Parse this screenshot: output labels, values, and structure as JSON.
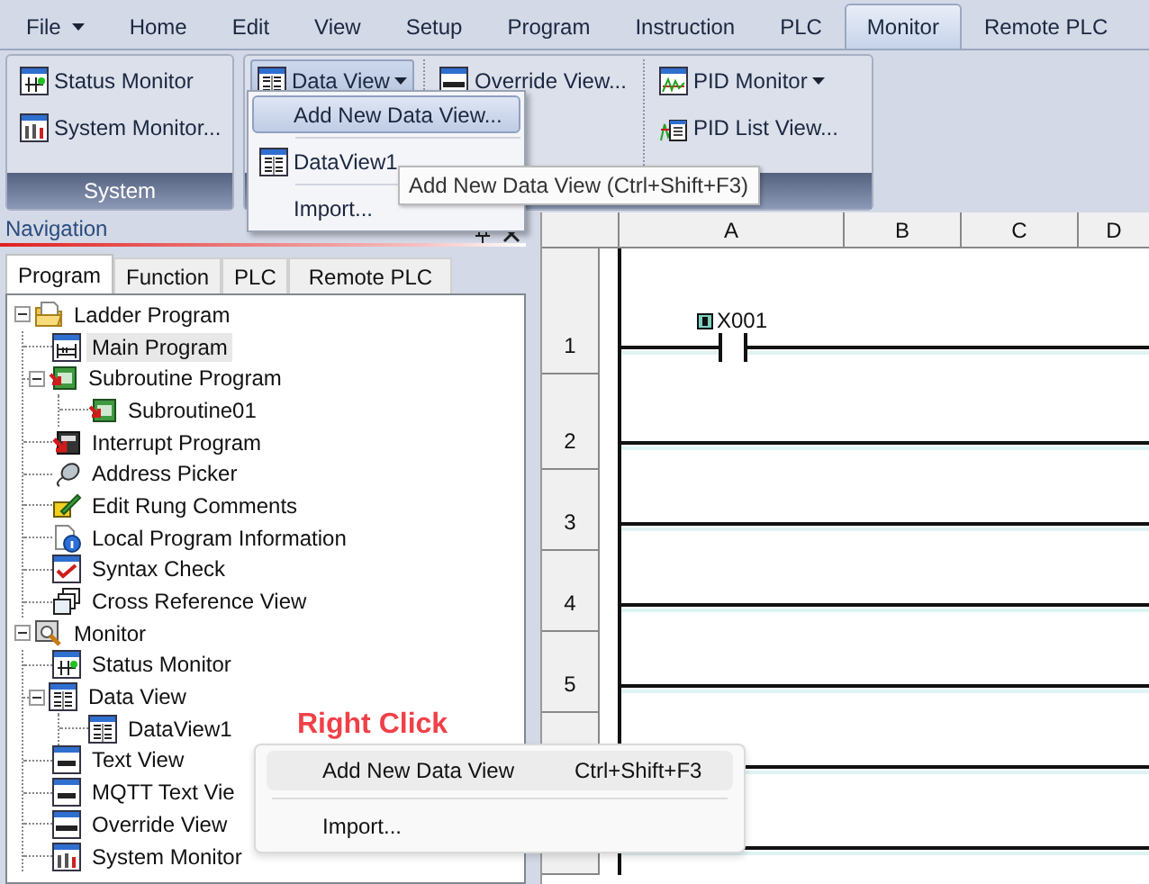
{
  "menu_tabs": [
    {
      "label": "File",
      "dropdown": true,
      "selected": false
    },
    {
      "label": "Home",
      "dropdown": false,
      "selected": false
    },
    {
      "label": "Edit",
      "dropdown": false,
      "selected": false
    },
    {
      "label": "View",
      "dropdown": false,
      "selected": false
    },
    {
      "label": "Setup",
      "dropdown": false,
      "selected": false
    },
    {
      "label": "Program",
      "dropdown": false,
      "selected": false
    },
    {
      "label": "Instruction",
      "dropdown": false,
      "selected": false
    },
    {
      "label": "PLC",
      "dropdown": false,
      "selected": false
    },
    {
      "label": "Monitor",
      "dropdown": false,
      "selected": true
    },
    {
      "label": "Remote PLC",
      "dropdown": false,
      "selected": false
    }
  ],
  "ribbon": {
    "groups": [
      {
        "label": "System",
        "columns": [
          [
            {
              "label": "Status Monitor",
              "kind": "status",
              "dropdown": false,
              "pressed": false
            },
            {
              "label": "System Monitor...",
              "kind": "system",
              "dropdown": false,
              "pressed": false
            }
          ]
        ]
      },
      {
        "columns": [
          [
            {
              "label": "Data View",
              "kind": "dataview",
              "dropdown": true,
              "pressed": true
            }
          ],
          [
            {
              "label": "Override View...",
              "kind": "override",
              "dropdown": false,
              "pressed": false
            }
          ],
          [
            {
              "label": "PID Monitor",
              "kind": "pid",
              "dropdown": true,
              "pressed": false
            },
            {
              "label": "PID List View...",
              "kind": "pidlist",
              "dropdown": false,
              "pressed": false
            }
          ]
        ]
      }
    ]
  },
  "dropdown_menu": {
    "items": [
      {
        "kind": "command",
        "label": "Add New Data View...",
        "selected": true
      },
      {
        "kind": "view",
        "label": "DataView1",
        "selected": false
      },
      {
        "kind": "command",
        "label": "Import...",
        "selected": false
      }
    ]
  },
  "tooltip": "Add New Data View (Ctrl+Shift+F3)",
  "navigation": {
    "title": "Navigation",
    "tabs": [
      {
        "label": "Program",
        "selected": true
      },
      {
        "label": "Function",
        "selected": false
      },
      {
        "label": "PLC",
        "selected": false
      },
      {
        "label": "Remote PLC",
        "selected": false
      }
    ],
    "tree": [
      {
        "label": "Ladder Program",
        "kind": "folder",
        "selected": false,
        "expanded": true,
        "children": [
          {
            "label": "Main Program",
            "kind": "ladder",
            "selected": true
          },
          {
            "label": "Subroutine Program",
            "kind": "routine",
            "selected": false,
            "expanded": true,
            "children": [
              {
                "label": "Subroutine01",
                "kind": "routine",
                "selected": false
              }
            ]
          },
          {
            "label": "Interrupt Program",
            "kind": "interrupt",
            "selected": false
          },
          {
            "label": "Address Picker",
            "kind": "picker",
            "selected": false
          },
          {
            "label": "Edit Rung Comments",
            "kind": "comment",
            "selected": false
          },
          {
            "label": "Local Program Information",
            "kind": "info",
            "selected": false
          },
          {
            "label": "Syntax Check",
            "kind": "check",
            "selected": false
          },
          {
            "label": "Cross Reference View",
            "kind": "reference",
            "selected": false
          }
        ]
      },
      {
        "label": "Monitor",
        "kind": "monitor",
        "selected": false,
        "expanded": true,
        "children": [
          {
            "label": "Status Monitor",
            "kind": "status",
            "selected": false
          },
          {
            "label": "Data View",
            "kind": "dataview",
            "selected": false,
            "expanded": true,
            "children": [
              {
                "label": "DataView1",
                "kind": "dataview",
                "selected": false
              }
            ]
          },
          {
            "label": "Text View",
            "kind": "text",
            "selected": false
          },
          {
            "label": "MQTT Text Vie",
            "kind": "text",
            "selected": false
          },
          {
            "label": "Override View",
            "kind": "override",
            "selected": false
          },
          {
            "label": "System Monitor",
            "kind": "system",
            "selected": false
          }
        ]
      }
    ]
  },
  "ladder": {
    "columns": [
      "A",
      "B",
      "C",
      "D"
    ],
    "rungs": [
      {
        "number": "1",
        "contacts": [
          "X001"
        ]
      },
      {
        "number": "2"
      },
      {
        "number": "3"
      },
      {
        "number": "4"
      },
      {
        "number": "5"
      }
    ]
  },
  "annotation": "Right Click",
  "context_menu": {
    "items": [
      {
        "label": "Add New Data View",
        "shortcut": "Ctrl+Shift+F3",
        "selected": true
      },
      {
        "label": "Import...",
        "selected": false
      }
    ]
  }
}
